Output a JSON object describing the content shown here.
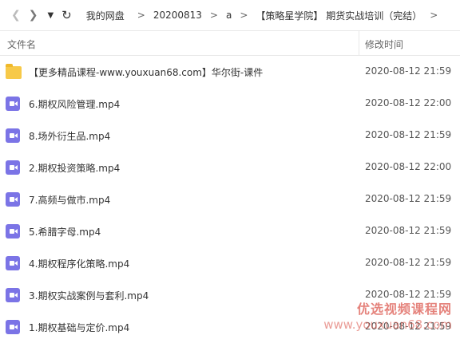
{
  "nav": {
    "back_icon": "chevron-left-icon",
    "forward_icon": "chevron-right-icon",
    "dropdown_icon": "caret-down-icon",
    "refresh_icon": "refresh-icon",
    "breadcrumbs": [
      "我的网盘",
      "20200813",
      "a",
      "【策略星学院】 期货实战培训（完结）"
    ],
    "separator": ">"
  },
  "columns": {
    "name": "文件名",
    "modified": "修改时间"
  },
  "files": [
    {
      "name": "【更多精品课程-www.youxuan68.com】华尔街-课件",
      "time": "2020-08-12 21:59",
      "type": "folder"
    },
    {
      "name": "6.期权风险管理.mp4",
      "time": "2020-08-12 22:00",
      "type": "video"
    },
    {
      "name": "8.场外衍生品.mp4",
      "time": "2020-08-12 21:59",
      "type": "video"
    },
    {
      "name": "2.期权投资策略.mp4",
      "time": "2020-08-12 22:00",
      "type": "video"
    },
    {
      "name": "7.高频与做市.mp4",
      "time": "2020-08-12 21:59",
      "type": "video"
    },
    {
      "name": "5.希腊字母.mp4",
      "time": "2020-08-12 21:59",
      "type": "video"
    },
    {
      "name": "4.期权程序化策略.mp4",
      "time": "2020-08-12 21:59",
      "type": "video"
    },
    {
      "name": "3.期权实战案例与套利.mp4",
      "time": "2020-08-12 21:59",
      "type": "video"
    },
    {
      "name": "1.期权基础与定价.mp4",
      "time": "2020-08-12 21:59",
      "type": "video"
    }
  ],
  "watermark": {
    "line1": "优选视频课程网",
    "line2": "www.youxuan68.com"
  },
  "colors": {
    "folder": "#f7c948",
    "video": "#7b74e6",
    "watermark": "#dc5a50"
  }
}
